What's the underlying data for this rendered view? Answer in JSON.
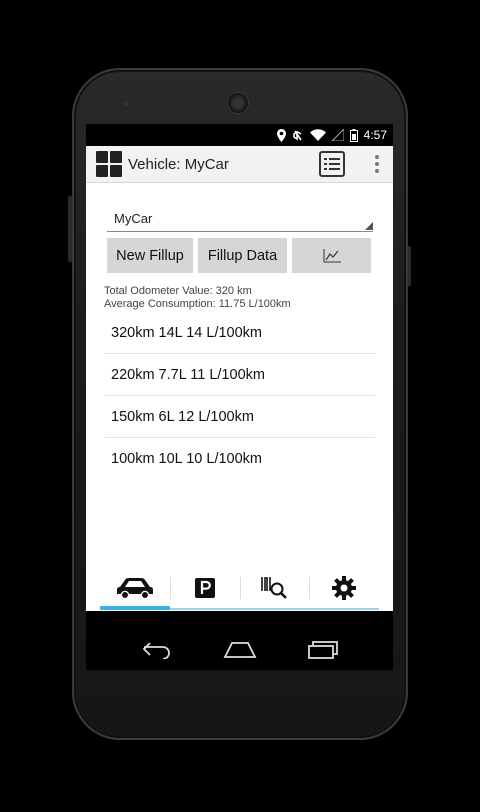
{
  "status_bar": {
    "time": "4:57",
    "icons": [
      "location-icon",
      "mute-icon",
      "wifi-icon",
      "signal-icon",
      "battery-icon"
    ]
  },
  "action_bar": {
    "title": "Vehicle: MyCar",
    "icons": [
      "app-icon",
      "list-icon",
      "overflow-menu-icon"
    ]
  },
  "vehicle_spinner": {
    "selected": "MyCar"
  },
  "buttons": {
    "new_fillup": "New Fillup",
    "fillup_data": "Fillup Data",
    "chart_icon": "chart-icon"
  },
  "stats": {
    "total_odometer": "Total Odometer Value: 320 km",
    "avg_consumption": "Average Consumption: 11.75 L/100km"
  },
  "fillups": [
    {
      "text": "320km  14L 14 L/100km"
    },
    {
      "text": "220km  7.7L 11 L/100km"
    },
    {
      "text": "150km  6L 12 L/100km"
    },
    {
      "text": "100km  10L 10 L/100km"
    }
  ],
  "bottom_tabs": [
    {
      "icon": "car-icon",
      "active": true
    },
    {
      "icon": "parking-icon",
      "active": false
    },
    {
      "icon": "barcode-search-icon",
      "active": false
    },
    {
      "icon": "settings-gear-icon",
      "active": false
    }
  ],
  "nav_bar": {
    "icons": [
      "back-icon",
      "home-icon",
      "recents-icon"
    ]
  },
  "colors": {
    "accent": "#33b5e5",
    "action_bar": "#f2f2f2",
    "button": "#d6d6d6"
  }
}
